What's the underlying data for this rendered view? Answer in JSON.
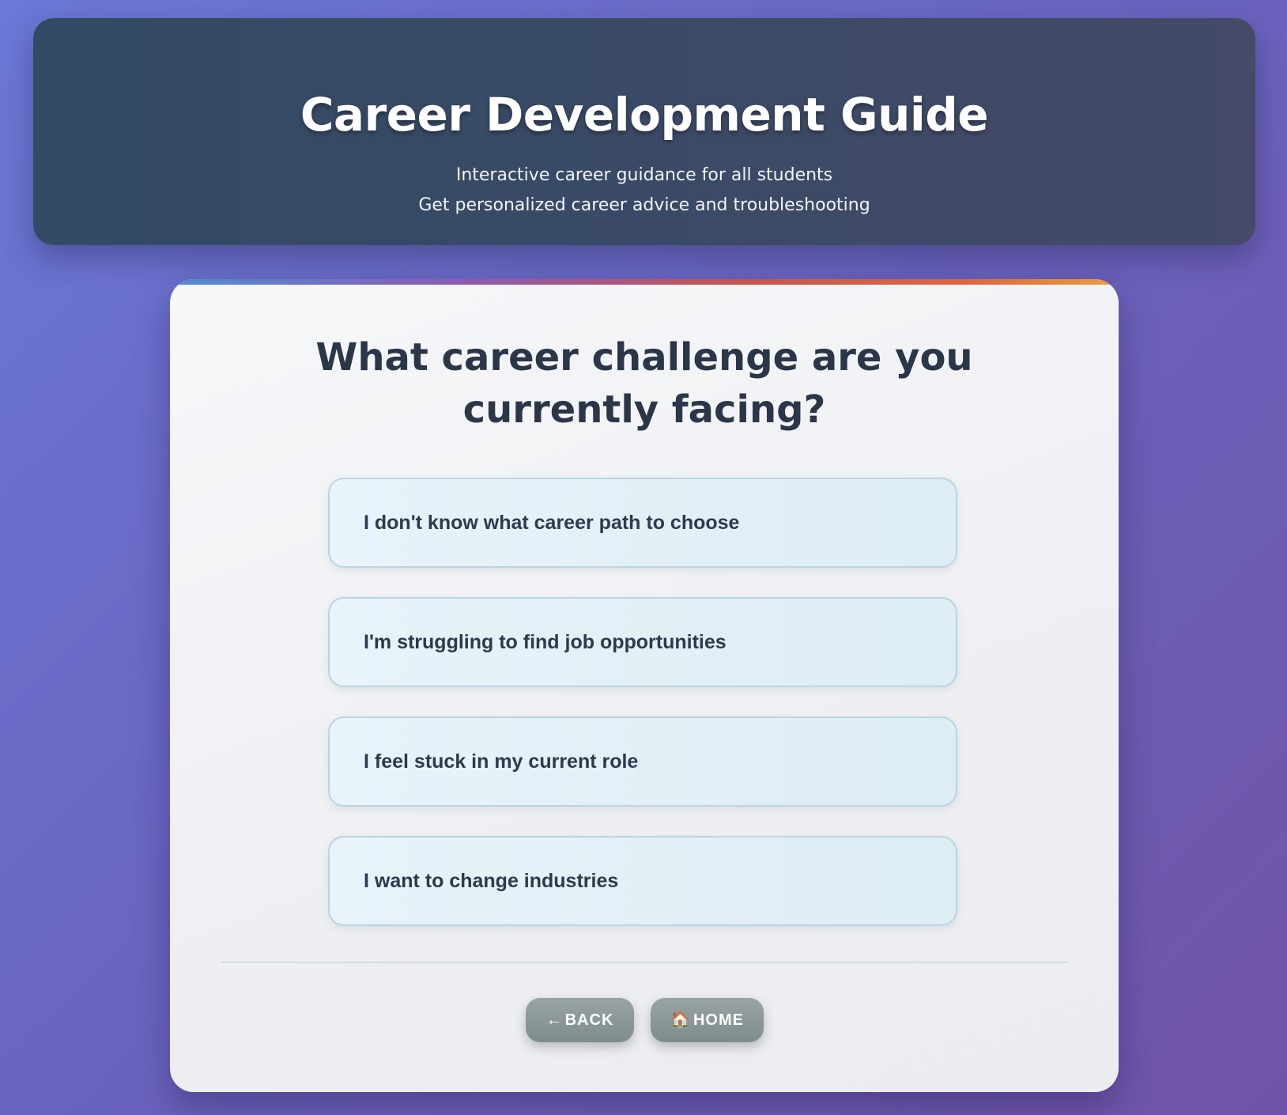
{
  "header": {
    "title": "Career Development Guide",
    "subtitle_line1": "Interactive career guidance for all students",
    "subtitle_line2": "Get personalized career advice and troubleshooting"
  },
  "card": {
    "question": "What career challenge are you currently facing?",
    "options": [
      {
        "label": "I don't know what career path to choose"
      },
      {
        "label": "I'm struggling to find job opportunities"
      },
      {
        "label": "I feel stuck in my current role"
      },
      {
        "label": "I want to change industries"
      }
    ],
    "nav": {
      "back_icon": "←",
      "back_label": "BACK",
      "home_icon": "🏠",
      "home_label": "HOME"
    }
  },
  "colors": {
    "accent_gradient": [
      "#4e8ed6",
      "#8b5bb4",
      "#c9534e",
      "#e0683c",
      "#eba03a"
    ],
    "header_bg": "#36495f",
    "question_text": "#2b3648",
    "nav_button": "#8a9697"
  }
}
